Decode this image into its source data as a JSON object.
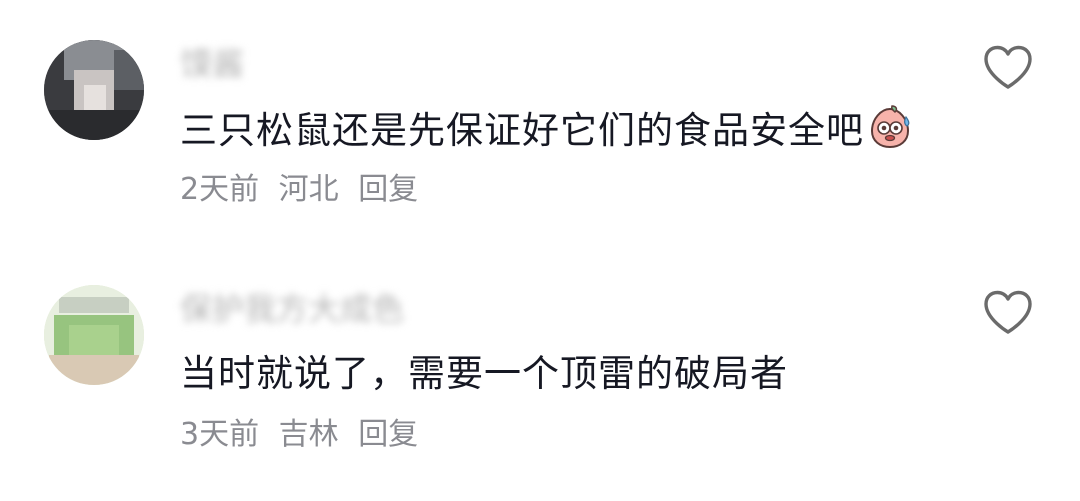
{
  "comments": [
    {
      "username": "馍酱",
      "text": "三只松鼠还是先保证好它们的食品安全吧",
      "emoji": "sweat-face-emoji",
      "time": "2天前",
      "location": "河北",
      "reply_label": "回复"
    },
    {
      "username": "保护我方大成色",
      "text": "当时就说了，需要一个顶雷的破局者",
      "time": "3天前",
      "location": "吉林",
      "reply_label": "回复"
    }
  ],
  "colors": {
    "text": "#161823",
    "meta": "#8a8b91",
    "username": "#b4b4b4",
    "icon": "#6b6b6b"
  }
}
